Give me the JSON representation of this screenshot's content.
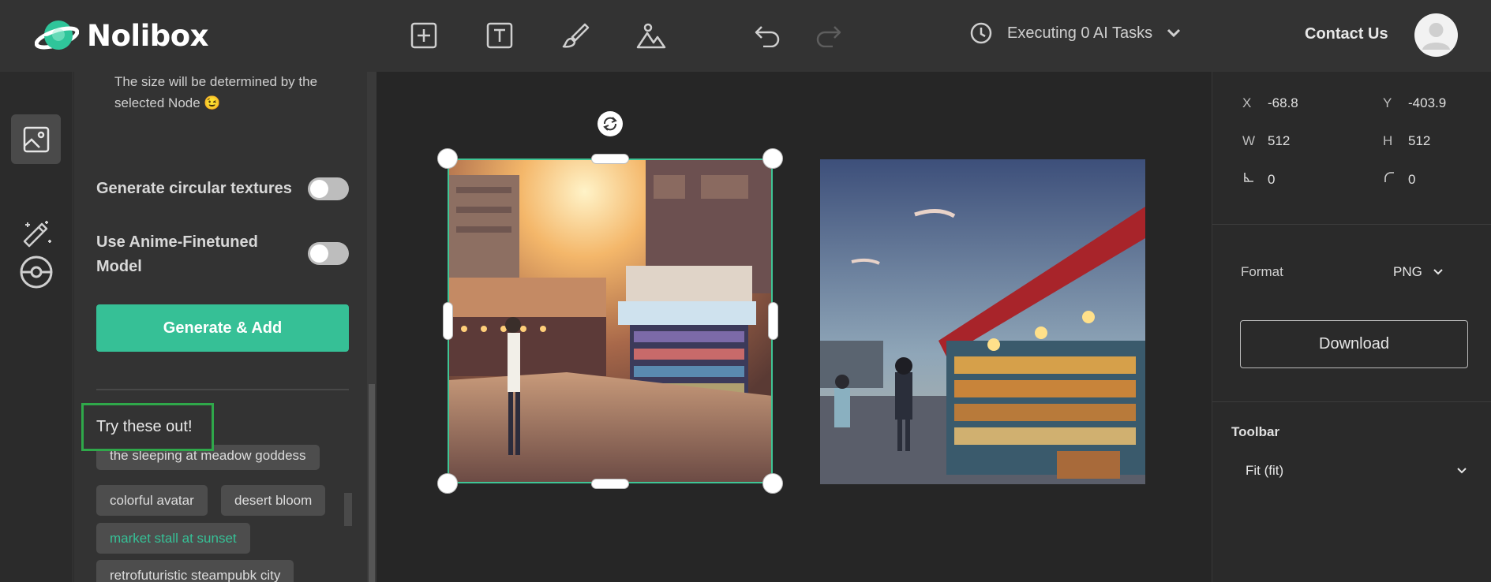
{
  "app": {
    "name": "Nolibox"
  },
  "toolbar": {
    "icons": [
      "add-frame-icon",
      "text-icon",
      "brush-icon",
      "image-icon",
      "undo-icon",
      "redo-icon"
    ]
  },
  "tasks": {
    "label": "Executing 0 AI Tasks"
  },
  "header": {
    "contact": "Contact Us"
  },
  "left_panel": {
    "hint": "The size will be determined by the selected Node",
    "hint_emoji": "😉",
    "options": [
      {
        "label": "Generate circular textures",
        "on": false
      },
      {
        "label": "Use Anime-Finetuned Model",
        "on": false
      }
    ],
    "generate_button": "Generate & Add",
    "try_title": "Try these out!",
    "chips": [
      "the sleeping at meadow goddess",
      "colorful avatar",
      "desert bloom",
      "market stall at sunset",
      "retrofuturistic steampubk city"
    ],
    "selected_chip": "market stall at sunset"
  },
  "props": {
    "x_label": "X",
    "x": "-68.8",
    "y_label": "Y",
    "y": "-403.9",
    "w_label": "W",
    "w": "512",
    "h_label": "H",
    "h": "512",
    "skew": "0",
    "radius": "0",
    "format_label": "Format",
    "format_value": "PNG",
    "download": "Download",
    "toolbar_title": "Toolbar",
    "fit_value": "Fit (fit)"
  },
  "colors": {
    "accent": "#36c096",
    "highlight": "#2fa84a",
    "panel": "#333333",
    "canvas": "#262626"
  }
}
